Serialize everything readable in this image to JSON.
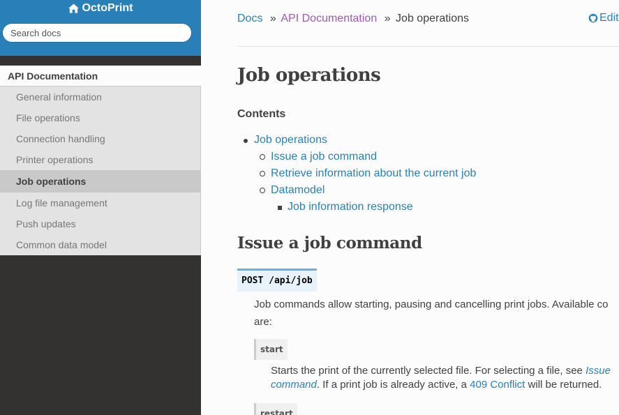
{
  "sidebar": {
    "brand": "OctoPrint",
    "search_placeholder": "Search docs",
    "current_section": "API Documentation",
    "items": [
      {
        "label": "General information",
        "active": false
      },
      {
        "label": "File operations",
        "active": false
      },
      {
        "label": "Connection handling",
        "active": false
      },
      {
        "label": "Printer operations",
        "active": false
      },
      {
        "label": "Job operations",
        "active": true
      },
      {
        "label": "Log file management",
        "active": false
      },
      {
        "label": "Push updates",
        "active": false
      },
      {
        "label": "Common data model",
        "active": false
      }
    ]
  },
  "breadcrumb": {
    "docs": "Docs",
    "sep": "»",
    "api_docs": "API Documentation",
    "current": "Job operations",
    "edit": "Edit"
  },
  "page": {
    "title": "Job operations",
    "contents_title": "Contents",
    "toc": [
      {
        "label": "Job operations",
        "level": 1
      },
      {
        "label": "Issue a job command",
        "level": 2
      },
      {
        "label": "Retrieve information about the current job",
        "level": 2
      },
      {
        "label": "Datamodel",
        "level": 2
      },
      {
        "label": "Job information response",
        "level": 3
      }
    ],
    "section_title": "Issue a job command",
    "endpoint": "POST /api/job",
    "intro_line1": "Job commands allow starting, pausing and cancelling print jobs. Available co",
    "intro_line2": "are:",
    "start_label": "start",
    "start_desc_1a": "Starts the print of the currently selected file. For selecting a file, see ",
    "start_desc_1_link": "Issue",
    "start_desc_2_link": "command",
    "start_desc_2b": ". If a print job is already active, a ",
    "start_desc_2_link2": "409 Conflict",
    "start_desc_2c": " will be returned.",
    "restart_label": "restart"
  },
  "colors": {
    "accent": "#2980b9",
    "visited": "#9b59b6",
    "sidebar_dark": "#343131"
  }
}
